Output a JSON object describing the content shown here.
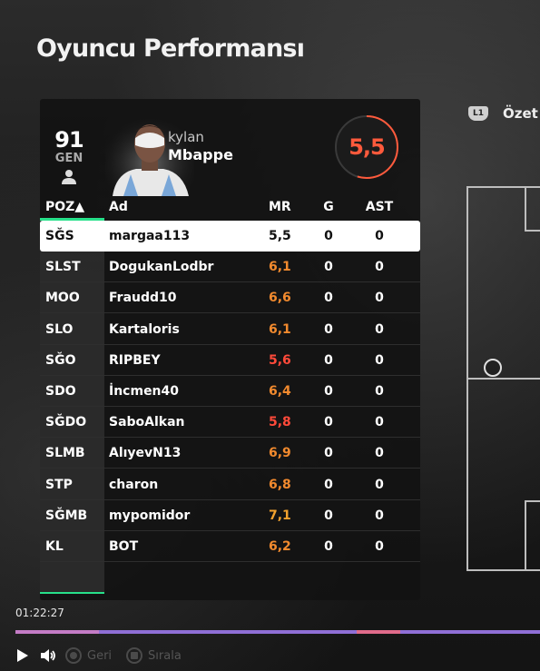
{
  "page": {
    "title": "Oyuncu Performansı"
  },
  "summary_tab": {
    "badge": "L1",
    "label": "Özet"
  },
  "player": {
    "overall": "91",
    "overall_label": "GEN",
    "first_name": "kylan",
    "last_name": "Mbappe",
    "rating": "5,5"
  },
  "table": {
    "headers": {
      "pos": "POZ▲",
      "name": "Ad",
      "mr": "MR",
      "g": "G",
      "ast": "AST"
    },
    "rows": [
      {
        "pos": "SĞS",
        "name": "margaa113",
        "mr": "5,5",
        "g": "0",
        "ast": "0",
        "mr_color": "#111111"
      },
      {
        "pos": "SLST",
        "name": "DogukanLodbr",
        "mr": "6,1",
        "g": "0",
        "ast": "0",
        "mr_color": "#f28a2e"
      },
      {
        "pos": "MOO",
        "name": "Fraudd10",
        "mr": "6,6",
        "g": "0",
        "ast": "0",
        "mr_color": "#f28a2e"
      },
      {
        "pos": "SLO",
        "name": "Kartaloris",
        "mr": "6,1",
        "g": "0",
        "ast": "0",
        "mr_color": "#f28a2e"
      },
      {
        "pos": "SĞO",
        "name": "RIPBEY",
        "mr": "5,6",
        "g": "0",
        "ast": "0",
        "mr_color": "#ff4a3a"
      },
      {
        "pos": "SDO",
        "name": "İncmen40",
        "mr": "6,4",
        "g": "0",
        "ast": "0",
        "mr_color": "#f28a2e"
      },
      {
        "pos": "SĞDO",
        "name": "SaboAlkan",
        "mr": "5,8",
        "g": "0",
        "ast": "0",
        "mr_color": "#ff4a3a"
      },
      {
        "pos": "SLMB",
        "name": "AlıyevN13",
        "mr": "6,9",
        "g": "0",
        "ast": "0",
        "mr_color": "#f28a2e"
      },
      {
        "pos": "STP",
        "name": "charon",
        "mr": "6,8",
        "g": "0",
        "ast": "0",
        "mr_color": "#f28a2e"
      },
      {
        "pos": "SĞMB",
        "name": "mypomidor",
        "mr": "7,1",
        "g": "0",
        "ast": "0",
        "mr_color": "#f2a22e"
      },
      {
        "pos": "KL",
        "name": "BOT",
        "mr": "6,2",
        "g": "0",
        "ast": "0",
        "mr_color": "#f28a2e"
      }
    ]
  },
  "playback": {
    "timestamp": "01:22:27",
    "progress_fraction": 0.16,
    "back_label": "Geri",
    "order_label": "Sırala",
    "play_icon": "play-icon",
    "volume_icon": "volume-icon"
  },
  "colors": {
    "accent_green": "#27e08a",
    "rating_red": "#ff5a3c",
    "progress": "#8f6fd6"
  }
}
